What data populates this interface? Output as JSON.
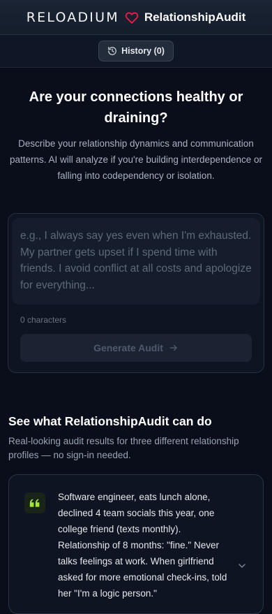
{
  "header": {
    "logo_text": "RELOADIUM",
    "app_name": "RelationshipAudit",
    "heart_color": "#e11d48"
  },
  "history": {
    "label": "History (0)",
    "icon": "history-icon"
  },
  "hero": {
    "title": "Are your connections healthy or draining?",
    "description": "Describe your relationship dynamics and communication patterns. AI will analyze if you're building interdependence or falling into codependency or isolation."
  },
  "form": {
    "placeholder": "e.g., I always say yes even when I'm exhausted. My partner gets upset if I spend time with friends. I avoid conflict at all costs and apologize for everything...",
    "char_count": "0 characters",
    "submit_label": "Generate Audit"
  },
  "examples": {
    "title": "See what RelationshipAudit can do",
    "description": "Real-looking audit results for three different relationship profiles — no sign-in needed.",
    "items": [
      {
        "text": "Software engineer, eats lunch alone, declined 4 team socials this year, one college friend (texts monthly). Relationship of 8 months: \"fine.\" Never talks feelings at work. When girlfriend asked for more emotional check-ins, told her \"I'm a logic person.\"",
        "accent": "#a3e635"
      }
    ]
  }
}
